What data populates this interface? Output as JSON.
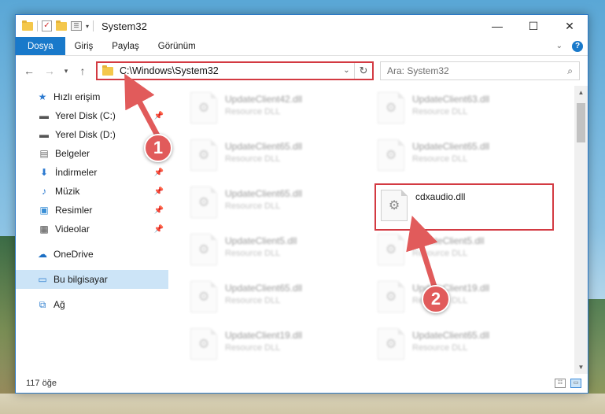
{
  "window": {
    "title": "System32",
    "controls": {
      "minimize": "—",
      "maximize": "☐",
      "close": "✕"
    }
  },
  "ribbon": {
    "tabs": [
      "Dosya",
      "Giriş",
      "Paylaş",
      "Görünüm"
    ]
  },
  "address": {
    "path": "C:\\Windows\\System32",
    "search_placeholder": "Ara: System32"
  },
  "nav": {
    "quick_access": "Hızlı erişim",
    "items": [
      {
        "label": "Yerel Disk (C:)",
        "icon": "drive-icon",
        "pinned": true
      },
      {
        "label": "Yerel Disk (D:)",
        "icon": "drive-icon",
        "pinned": false
      },
      {
        "label": "Belgeler",
        "icon": "documents-icon",
        "pinned": true
      },
      {
        "label": "İndirmeler",
        "icon": "download-icon",
        "pinned": true
      },
      {
        "label": "Müzik",
        "icon": "music-icon",
        "pinned": true
      },
      {
        "label": "Resimler",
        "icon": "pictures-icon",
        "pinned": true
      },
      {
        "label": "Videolar",
        "icon": "videos-icon",
        "pinned": true
      }
    ],
    "onedrive": "OneDrive",
    "this_pc": "Bu bilgisayar",
    "network": "Ağ"
  },
  "files": {
    "col1": [
      {
        "name": "UpdateClient42.dll",
        "type": "Resource DLL"
      },
      {
        "name": "UpdateClient65.dll",
        "type": "Resource DLL"
      },
      {
        "name": "UpdateClient65.dll",
        "type": "Resource DLL"
      },
      {
        "name": "UpdateClient5.dll",
        "type": "Resource DLL"
      },
      {
        "name": "UpdateClient65.dll",
        "type": "Resource DLL"
      },
      {
        "name": "UpdateClient19.dll",
        "type": "Resource DLL"
      }
    ],
    "col2": [
      {
        "name": "UpdateClient63.dll",
        "type": "Resource DLL"
      },
      {
        "name": "UpdateClient65.dll",
        "type": "Resource DLL"
      },
      {
        "name": "cdxaudio.dll",
        "type": ""
      },
      {
        "name": "UpdateClient5.dll",
        "type": "Resource DLL"
      },
      {
        "name": "UpdateClient19.dll",
        "type": "Resource DLL"
      },
      {
        "name": "UpdateClient65.dll",
        "type": "Resource DLL"
      }
    ]
  },
  "status": {
    "count": "117 öğe"
  },
  "annotations": {
    "step1": "1",
    "step2": "2",
    "color": "#e15b5b"
  }
}
